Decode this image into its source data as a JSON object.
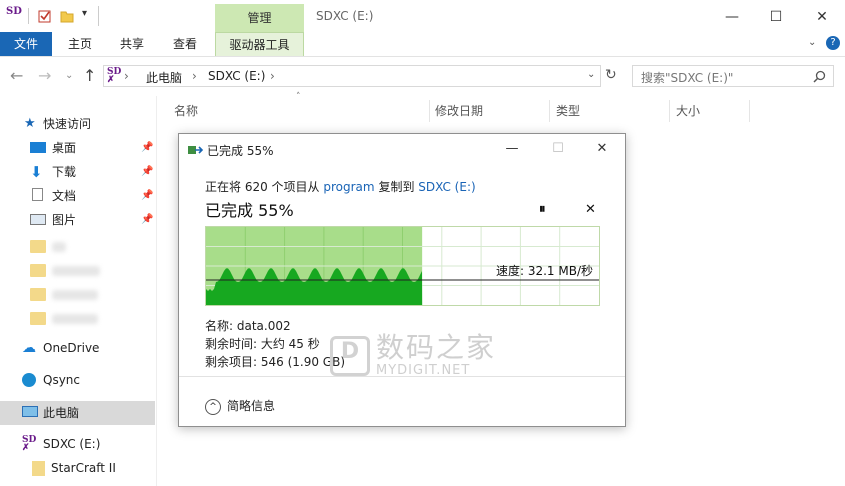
{
  "window": {
    "title": "SDXC (E:)",
    "app_logo": "SD",
    "manage_tab": "管理",
    "controls": {
      "minimize": "—",
      "maximize": "☐",
      "close": "✕"
    }
  },
  "ribbon": {
    "tabs": [
      "文件",
      "主页",
      "共享",
      "查看",
      "驱动器工具"
    ]
  },
  "address": {
    "crumbs": [
      "此电脑",
      "SDXC (E:)"
    ],
    "search_placeholder": "搜索\"SDXC (E:)\""
  },
  "sidebar": {
    "quick_access": "快速访问",
    "pinned": [
      "桌面",
      "下载",
      "文档",
      "图片"
    ],
    "onedrive": "OneDrive",
    "qsync": "Qsync",
    "this_pc": "此电脑",
    "drive": "SDXC (E:)",
    "folder": "StarCraft II"
  },
  "columns": [
    "名称",
    "修改日期",
    "类型",
    "大小"
  ],
  "dialog": {
    "title": "已完成 55%",
    "copy_prefix": "正在将 620 个项目从",
    "source": "program",
    "copy_mid": "复制到",
    "dest": "SDXC (E:)",
    "percent_label": "已完成 55%",
    "pause_icon": "⏸",
    "cancel_icon": "✕",
    "speed": "速度: 32.1 MB/秒",
    "name": "名称: data.002",
    "time_left": "剩余时间: 大约 45 秒",
    "items_left": "剩余项目: 546 (1.90 GB)",
    "details": "简略信息",
    "progress": 0.55
  },
  "watermark": {
    "cn": "数码之家",
    "en": "MYDIGIT.NET"
  }
}
